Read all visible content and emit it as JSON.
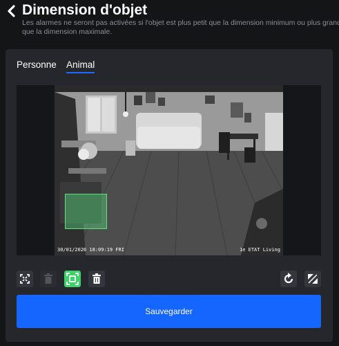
{
  "header": {
    "title": "Dimension d'objet",
    "subtitle": "Les alarmes ne seront pas activées si l'objet est plus petit que la dimension minimum ou plus grand que la dimension maximale."
  },
  "tabs": [
    {
      "label": "Personne",
      "active": false
    },
    {
      "label": "Animal",
      "active": true
    }
  ],
  "video": {
    "timestamp": "30/01/2026 18:09:19 FRI",
    "camera_name": "1e ETAT Living"
  },
  "toolbar": {
    "left": [
      "fit-screen-icon",
      "trash-icon",
      "expand-icon",
      "trash-icon"
    ],
    "right": [
      "reset-icon",
      "resize-icon"
    ]
  },
  "save_label": "Sauvegarder",
  "colors": {
    "accent": "#1565ff",
    "detection": "#3fd26b",
    "panel": "#25272d",
    "background": "#141517"
  }
}
